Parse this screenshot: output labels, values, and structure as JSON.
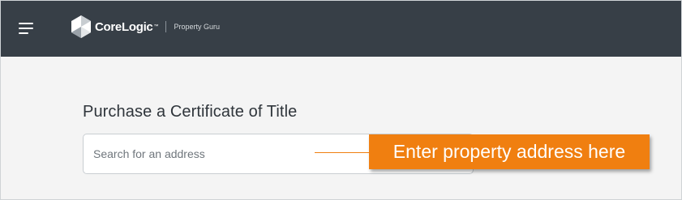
{
  "app": {
    "brand": "CoreLogic",
    "product": "Property Guru"
  },
  "page": {
    "title": "Purchase a Certificate of Title"
  },
  "search": {
    "placeholder": "Search for an address",
    "value": ""
  },
  "annotation": {
    "text": "Enter property address here"
  },
  "colors": {
    "topbar": "#373f47",
    "background": "#f4f4f4",
    "callout": "#f07f10",
    "text": "#2f353b"
  },
  "icons": {
    "menu": "hamburger-menu-icon",
    "logo": "corelogic-logo-icon"
  }
}
